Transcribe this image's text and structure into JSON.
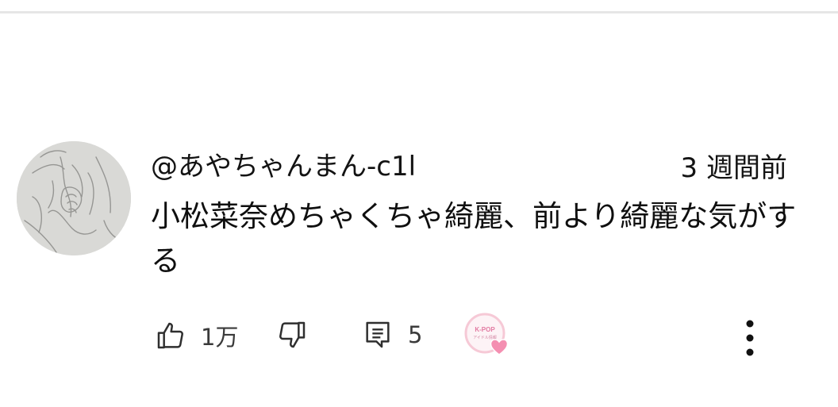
{
  "comment": {
    "author": "@あやちゃんまん-c1l",
    "timestamp": "3 週間前",
    "text": "小松菜奈めちゃくちゃ綺麗、前より綺麗な気がする",
    "avatar_icon": "sketch-portrait-avatar"
  },
  "actions": {
    "like_icon": "thumbs-up-icon",
    "like_count": "1万",
    "dislike_icon": "thumbs-down-icon",
    "reply_icon": "comment-icon",
    "reply_count": "5",
    "creator_badge": {
      "top_text": "",
      "title": "K-POP",
      "subtitle": "アイドル情報",
      "heart_color": "#f48fb1",
      "ring_color": "#f6c9d6"
    },
    "more_icon": "more-vertical-icon"
  },
  "colors": {
    "text": "#0f0f0f",
    "secondary_text": "#3a3a3a",
    "divider": "#e6e6e6"
  }
}
